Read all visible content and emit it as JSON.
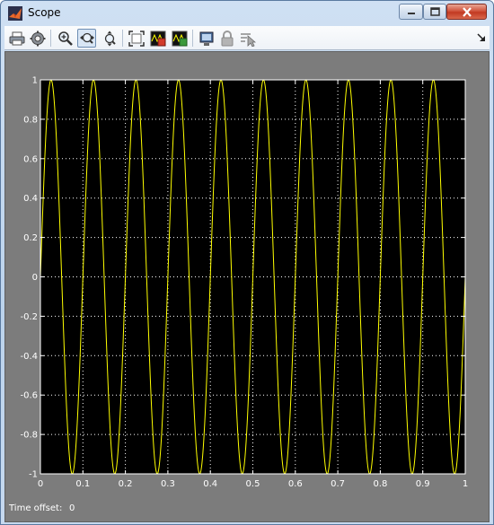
{
  "window": {
    "title": "Scope",
    "accent_color": "#d9553c"
  },
  "toolbar": {
    "buttons": [
      {
        "icon": "print-icon"
      },
      {
        "icon": "parameters-gear-icon"
      },
      {
        "icon": "zoom-in-icon"
      },
      {
        "icon": "zoom-x-axis-icon",
        "active": true
      },
      {
        "icon": "zoom-y-axis-icon"
      },
      {
        "icon": "autoscale-icon"
      },
      {
        "icon": "save-axes-settings-icon"
      },
      {
        "icon": "restore-axes-settings-icon"
      },
      {
        "icon": "floating-scope-icon"
      },
      {
        "icon": "lock-axes-icon"
      },
      {
        "icon": "signal-selector-icon"
      }
    ]
  },
  "status": {
    "time_offset_label": "Time offset:",
    "time_offset_value": "0"
  },
  "chart_data": {
    "type": "line",
    "title": "",
    "xlabel": "",
    "ylabel": "",
    "xlim": [
      0,
      1
    ],
    "ylim": [
      -1,
      1
    ],
    "x_ticks": [
      "0",
      "0.1",
      "0.2",
      "0.3",
      "0.4",
      "0.5",
      "0.6",
      "0.7",
      "0.8",
      "0.9",
      "1"
    ],
    "y_ticks": [
      "1",
      "0.8",
      "0.6",
      "0.4",
      "0.2",
      "0",
      "-0.2",
      "-0.4",
      "-0.6",
      "-0.8",
      "-1"
    ],
    "grid": true,
    "background_color": "#000000",
    "line_color": "#ffff00",
    "series": [
      {
        "function": "sine",
        "amplitude": 1,
        "frequency_hz": 10,
        "phase": 0
      }
    ]
  }
}
